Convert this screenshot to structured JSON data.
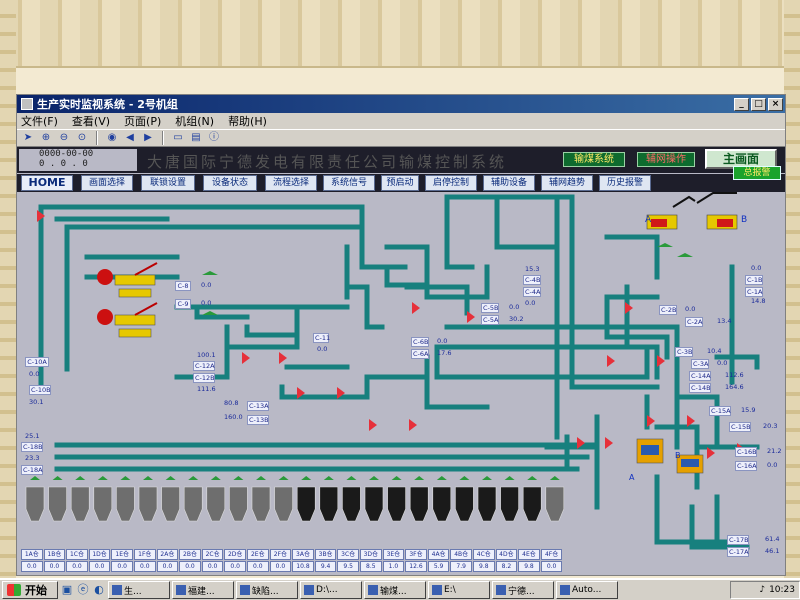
{
  "window": {
    "title": "生产实时监视系统 - 2号机组",
    "controls": [
      "_",
      "□",
      "×"
    ]
  },
  "menu": [
    "文件(F)",
    "查看(V)",
    "页面(P)",
    "机组(N)",
    "帮助(H)"
  ],
  "toolbar_icons": [
    "pointer-icon",
    "zoom-in-icon",
    "zoom-out-icon",
    "zoom-fit-icon",
    "globe-icon",
    "back-icon",
    "forward-icon",
    "open-folder-icon",
    "print-icon",
    "info-icon"
  ],
  "header": {
    "counter_top": "0000-00-00",
    "counter_bottom": "0 . 0 . 0",
    "company": "大唐国际宁德发电有限责任公司输煤控制系统",
    "subsystem": "输煤系统",
    "operation": "辅网操作",
    "main_screen": "主画面",
    "alarm": "总报警"
  },
  "nav": [
    "HOME",
    "画面选择",
    "联锁设置",
    "设备状态",
    "流程选择",
    "系统信号",
    "预启动",
    "启停控制",
    "辅助设备",
    "辅网趋势",
    "历史报警"
  ],
  "labels": {
    "c8": "C-8",
    "c8v": "0.0",
    "c9": "C-9",
    "c9v": "0.0",
    "c10a": "C-10A",
    "c10av": "0.0",
    "c10b": "C-10B",
    "c10bv": "30.1",
    "c12a": "C-12A",
    "c12av": "100.1",
    "c12b": "C-12B",
    "c12bv": "111.6",
    "c11": "C-11",
    "c11v": "0.0",
    "c13a": "C-13A",
    "c13av": "80.8",
    "c13b": "C-13B",
    "c13bv": "160.0",
    "c5b": "C-5B",
    "c5bv": "0.0",
    "c5a": "C-5A",
    "c5av": "30.2",
    "c4b": "C-4B",
    "c4bv": "15.3",
    "c4a": "C-4A",
    "c4av": "0.0",
    "c6b": "C-6B",
    "c6bv": "0.0",
    "c6a": "C-6A",
    "c6av": "17.6",
    "c1b": "C-1B",
    "c1bv": "0.0",
    "c1a": "C-1A",
    "c1av": "14.8",
    "c2b": "C-2B",
    "c2bv": "0.0",
    "c2a": "C-2A",
    "c2av": "13.4",
    "c3b": "C-3B",
    "c3bv": "10.4",
    "c3a": "C-3A",
    "c3av": "0.0",
    "c14a": "C-14A",
    "c14av": "112.6",
    "c14b": "C-14B",
    "c14bv": "164.6",
    "c15a": "C-15A",
    "c15av": "15.9",
    "c15b": "C-15B",
    "c15bv": "20.3",
    "c16b": "C-16B",
    "c16bv": "21.2",
    "c16a": "C-16A",
    "c16av": "0.0",
    "c17b": "C-17B",
    "c17bv": "61.4",
    "c17a": "C-17A",
    "c17av": "46.1",
    "c18b": "C-18B",
    "c18bv": "25.1",
    "c18a": "C-18A",
    "c18av": "23.3",
    "stacker_a": "A",
    "stacker_b": "B",
    "lbl_a": "A",
    "lbl_b": "B"
  },
  "bunkers": {
    "names": [
      "1A仓",
      "1B仓",
      "1C仓",
      "1D仓",
      "1E仓",
      "1F仓",
      "2A仓",
      "2B仓",
      "2C仓",
      "2D仓",
      "2E仓",
      "2F仓",
      "3A仓",
      "3B仓",
      "3C仓",
      "3D仓",
      "3E仓",
      "3F仓",
      "4A仓",
      "4B仓",
      "4C仓",
      "4D仓",
      "4E仓",
      "4F仓"
    ],
    "values": [
      "0.0",
      "0.0",
      "0.0",
      "0.0",
      "0.0",
      "0.0",
      "0.0",
      "0.0",
      "0.0",
      "0.0",
      "0.0",
      "0.0",
      "10.8",
      "9.4",
      "9.5",
      "8.5",
      "1.0",
      "12.6",
      "5.9",
      "7.9",
      "9.8",
      "8.2",
      "9.8",
      "0.0"
    ]
  },
  "taskbar": {
    "start": "开始",
    "items": [
      "生...",
      "福建...",
      "缺陷...",
      "D:\\...",
      "输煤...",
      "E:\\",
      "宁德...",
      "Auto..."
    ],
    "clock": "10:23"
  },
  "colors": {
    "pipe": "#17807e",
    "bg": "#b9b9c6",
    "header": "#1e1e2a"
  }
}
